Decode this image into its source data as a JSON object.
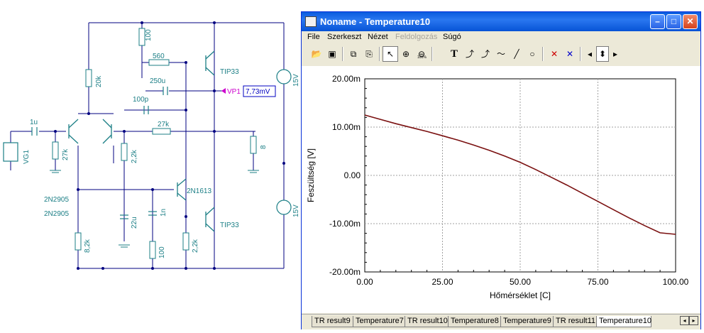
{
  "schematic": {
    "labels": {
      "r_100_top": "100",
      "r_560": "560",
      "q_tip33_top": "TIP33",
      "r_20k": "20k",
      "c_250u": "250u",
      "probe_vp1": "VP1",
      "probe_value": "7,73mV",
      "c_100p": "100p",
      "v_15v_top": "15V",
      "c_1u": "1u",
      "r_27k_fb": "27k",
      "r_27k_in": "27k",
      "vg1": "VG1",
      "r_2_2k_mid": "2,2k",
      "r_8_load": "8",
      "q_2n1613": "2N1613",
      "q_2n2905_a": "2N2905",
      "q_2n2905_b": "2N2905",
      "v_15v_bot": "15V",
      "c_22u": "22u",
      "c_1n": "1n",
      "q_tip33_bot": "TIP33",
      "r_8_2k": "8,2k",
      "r_100_bot": "100",
      "r_2_2k_bot": "2,2k"
    }
  },
  "window": {
    "title": "Noname - Temperature10",
    "menu": [
      "File",
      "Szerkeszt",
      "Nézet",
      "Feldolgozás",
      "Súgó"
    ],
    "menu_disabled_index": 3
  },
  "toolbar": {
    "icons": [
      "open-icon",
      "save-icon",
      "copy-icon",
      "paste-icon",
      "pointer-icon",
      "zoom-in-icon",
      "zoom-out-icon",
      "text-icon",
      "cursor-a-icon",
      "cursor-b-icon",
      "curve-label-icon",
      "line-icon",
      "circle-icon",
      "cross-a-icon",
      "cross-b-icon",
      "arrow-left-icon",
      "arrow-updown-icon",
      "arrow-right-icon"
    ],
    "text_glyph": "T",
    "zoom_label": "100%"
  },
  "tabs": [
    "TR result9",
    "Temperature7",
    "TR result10",
    "Temperature8",
    "Temperature9",
    "TR result11",
    "Temperature10"
  ],
  "active_tab": 6,
  "colors": {
    "curve": "#7a1010",
    "schematic_wire": "#000080",
    "schematic_part": "#1c7f86",
    "probe": "#0000c0"
  },
  "chart_data": {
    "type": "line",
    "xlabel": "Hőmérséklet [C]",
    "ylabel": "Feszültség [V]",
    "xlim": [
      0,
      100
    ],
    "ylim": [
      -0.02,
      0.02
    ],
    "x_ticks": [
      "0.00",
      "25.00",
      "50.00",
      "75.00",
      "100.00"
    ],
    "y_ticks": [
      "20.00m",
      "10.00m",
      "0.00",
      "-10.00m",
      "-20.00m"
    ],
    "grid": true,
    "series": [
      {
        "x": [
          0,
          5,
          10,
          15,
          20,
          25,
          30,
          35,
          40,
          45,
          50,
          55,
          60,
          65,
          70,
          75,
          80,
          85,
          90,
          95,
          100
        ],
        "y": [
          0.0125,
          0.0116,
          0.0107,
          0.0099,
          0.0091,
          0.0082,
          0.0073,
          0.0063,
          0.0052,
          0.004,
          0.0027,
          0.0012,
          -0.0004,
          -0.002,
          -0.0037,
          -0.0054,
          -0.0071,
          -0.0088,
          -0.0104,
          -0.0119,
          -0.0122
        ]
      }
    ]
  }
}
